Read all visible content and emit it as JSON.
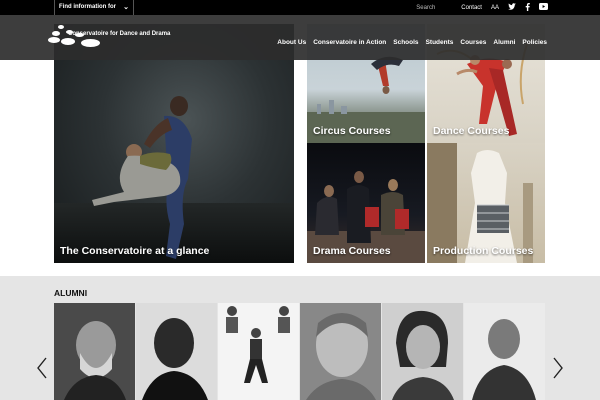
{
  "topbar": {
    "find_info_label": "Find information for",
    "search_label": "Search",
    "contact_label": "Contact",
    "text_size_label": "AA"
  },
  "header": {
    "logo_text": "Conservatoire for Dance and Drama",
    "nav": [
      "About Us",
      "Conservatoire in Action",
      "Schools",
      "Students",
      "Courses",
      "Alumni",
      "Policies"
    ]
  },
  "hero": {
    "main_caption": "The Conservatoire at a glance",
    "tiles": [
      "Circus Courses",
      "Dance Courses",
      "Drama Courses",
      "Production Courses"
    ]
  },
  "alumni": {
    "title": "ALUMNI"
  },
  "colors": {
    "topbar": "#000000",
    "header_overlay": "#2d2d2d",
    "alumni_background": "#e5e5e5"
  }
}
